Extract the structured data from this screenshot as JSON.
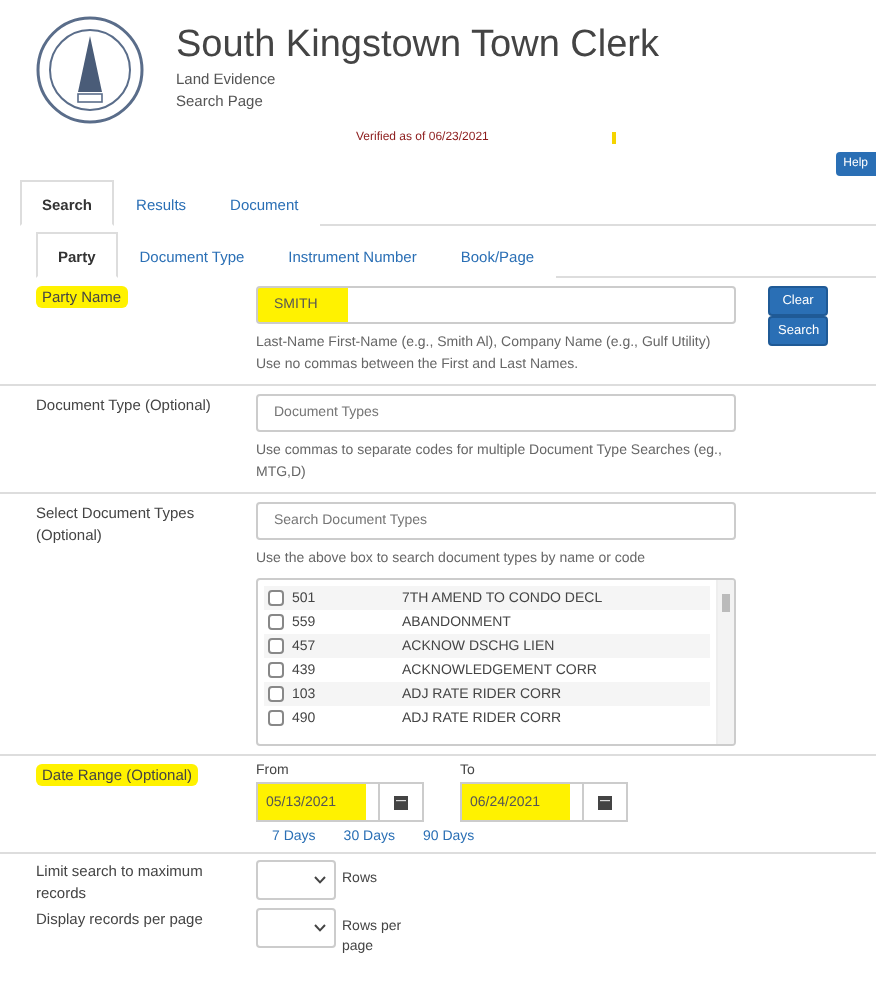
{
  "header": {
    "title": "South Kingstown Town Clerk",
    "subtitle_1": "Land Evidence",
    "subtitle_2": "Search Page",
    "verified": "Verified as of 06/23/2021",
    "help_button": "Help"
  },
  "tabs": [
    {
      "label": "Search",
      "selected": true
    },
    {
      "label": "Results",
      "selected": false
    },
    {
      "label": "Document",
      "selected": false
    }
  ],
  "subtabs": [
    {
      "label": "Party",
      "selected": true
    },
    {
      "label": "Document Type",
      "selected": false
    },
    {
      "label": "Instrument Number",
      "selected": false
    },
    {
      "label": "Book/Page",
      "selected": false
    }
  ],
  "party_name": {
    "label": "Party Name",
    "highlighted": true,
    "value": "SMITH",
    "help": "Last-Name First-Name (e.g., Smith Al), Company Name (e.g., Gulf Utility) Use no commas between the First and Last Names.",
    "buttons": [
      "Clear",
      "Search"
    ]
  },
  "document_type": {
    "label": "Document Type (Optional)",
    "placeholder": "Document Types",
    "help": "Use commas to separate codes for multiple Document Type Searches (eg., MTG,D)"
  },
  "select_document_types": {
    "label": "Select Document Types (Optional)",
    "placeholder": "Search Document Types",
    "help": "Use the above box to search document types by name or code",
    "items": [
      {
        "code": "501",
        "name": "7TH AMEND TO CONDO DECL",
        "checked": false
      },
      {
        "code": "559",
        "name": "ABANDONMENT",
        "checked": false
      },
      {
        "code": "457",
        "name": "ACKNOW DSCHG LIEN",
        "checked": false
      },
      {
        "code": "439",
        "name": "ACKNOWLEDGEMENT CORR",
        "checked": false
      },
      {
        "code": "103",
        "name": "ADJ RATE RIDER CORR",
        "checked": false
      },
      {
        "code": "490",
        "name": "ADJ RATE RIDER CORR",
        "checked": false
      }
    ]
  },
  "date_range": {
    "label": "Date Range (Optional)",
    "highlighted": true,
    "from_label": "From",
    "from_value": "05/13/2021",
    "to_label": "To",
    "to_value": "06/24/2021",
    "quick_links": [
      "7 Days",
      "30 Days",
      "90 Days"
    ]
  },
  "limits": [
    {
      "label": "Limit search to maximum records",
      "unit": "Rows"
    },
    {
      "label": "Display records per page",
      "unit": "Rows per page"
    }
  ]
}
